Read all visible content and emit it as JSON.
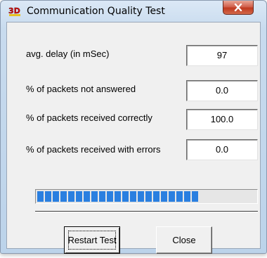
{
  "window": {
    "title": "Communication Quality Test",
    "app_icon_text": "3D",
    "close_icon": "close-x-icon"
  },
  "stats": [
    {
      "label": "avg. delay (in mSec)",
      "value": "97"
    },
    {
      "label": "% of packets not answered",
      "value": "0.0"
    },
    {
      "label": "% of packets received correctly",
      "value": "100.0"
    },
    {
      "label": "% of packets received with errors",
      "value": "0.0"
    }
  ],
  "progress": {
    "fraction": 0.75,
    "color": "#2a7fe0"
  },
  "buttons": {
    "restart_label": "Restart Test",
    "close_label": "Close"
  },
  "colors": {
    "close_button": "#c0391f",
    "progress_fill": "#2a7fe0"
  }
}
